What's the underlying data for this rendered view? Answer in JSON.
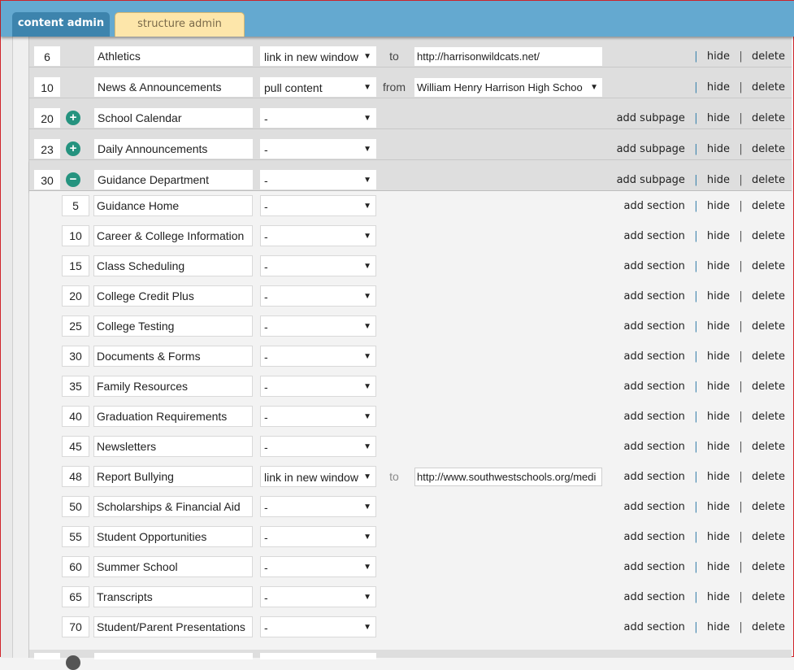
{
  "tabs": [
    {
      "label": "content admin",
      "active": true
    },
    {
      "label": "structure admin",
      "active": false
    }
  ],
  "actions": {
    "add_subpage": "add subpage",
    "add_section": "add section",
    "hide": "hide",
    "delete": "delete",
    "separator": "|"
  },
  "top_rows": [
    {
      "order": "6",
      "toggle": "",
      "title": "Athletics",
      "type": "link in new window",
      "connector": "to",
      "target": "http://harrisonwildcats.net/",
      "target_is_select": false,
      "add_label": ""
    },
    {
      "order": "10",
      "toggle": "",
      "title": "News & Announcements",
      "type": "pull content",
      "connector": "from",
      "target": "William Henry Harrison High Schoo",
      "target_is_select": true,
      "add_label": ""
    },
    {
      "order": "20",
      "toggle": "+",
      "title": "School Calendar",
      "type": "-",
      "connector": "",
      "target": "",
      "add_label": "add subpage"
    },
    {
      "order": "23",
      "toggle": "+",
      "title": "Daily Announcements",
      "type": "-",
      "connector": "",
      "target": "",
      "add_label": "add subpage"
    },
    {
      "order": "30",
      "toggle": "−",
      "title": "Guidance Department",
      "type": "-",
      "connector": "",
      "target": "",
      "add_label": "add subpage"
    }
  ],
  "sub_rows": [
    {
      "order": "5",
      "title": "Guidance Home",
      "type": "-"
    },
    {
      "order": "10",
      "title": "Career & College Information",
      "type": "-"
    },
    {
      "order": "15",
      "title": "Class Scheduling",
      "type": "-"
    },
    {
      "order": "20",
      "title": "College Credit Plus",
      "type": "-"
    },
    {
      "order": "25",
      "title": "College Testing",
      "type": "-"
    },
    {
      "order": "30",
      "title": "Documents & Forms",
      "type": "-"
    },
    {
      "order": "35",
      "title": "Family Resources",
      "type": "-"
    },
    {
      "order": "40",
      "title": "Graduation Requirements",
      "type": "-"
    },
    {
      "order": "45",
      "title": "Newsletters",
      "type": "-"
    },
    {
      "order": "48",
      "title": "Report Bullying",
      "type": "link in new window",
      "connector": "to",
      "target": "http://www.southwestschools.org/medi"
    },
    {
      "order": "50",
      "title": "Scholarships & Financial Aid",
      "type": "-"
    },
    {
      "order": "55",
      "title": "Student Opportunities",
      "type": "-"
    },
    {
      "order": "60",
      "title": "Summer School",
      "type": "-"
    },
    {
      "order": "65",
      "title": "Transcripts",
      "type": "-"
    },
    {
      "order": "70",
      "title": "Student/Parent Presentations",
      "type": "-"
    }
  ],
  "icons": {
    "dropdown": "▼"
  },
  "colors": {
    "header": "#64a9d0",
    "active_tab": "#3d84ad",
    "inactive_tab": "#fde6aa",
    "toggle": "#25937f"
  }
}
